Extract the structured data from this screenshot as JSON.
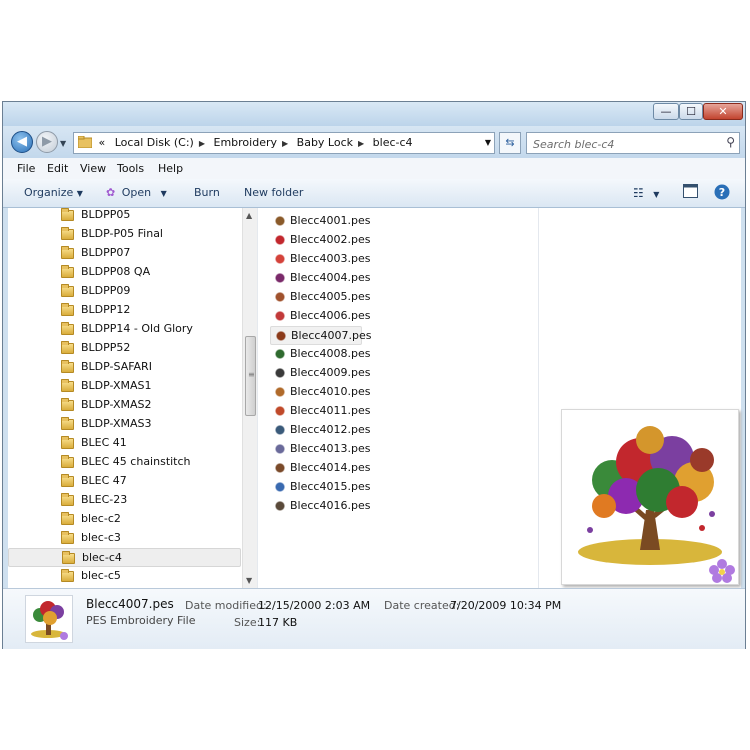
{
  "window": {
    "controls": {
      "minimize": "—",
      "maximize": "☐",
      "close": "✕"
    }
  },
  "address": {
    "overflow": "«",
    "crumbs": [
      "Local Disk (C:)",
      "Embroidery",
      "Baby Lock",
      "blec-c4"
    ],
    "search_placeholder": "Search blec-c4"
  },
  "menu": [
    "File",
    "Edit",
    "View",
    "Tools",
    "Help"
  ],
  "toolbar": {
    "organize": "Organize",
    "open": "Open",
    "burn": "Burn",
    "new_folder": "New folder"
  },
  "tree": [
    "BLDPP05",
    "BLDP-P05 Final",
    "BLDPP07",
    "BLDPP08 QA",
    "BLDPP09",
    "BLDPP12",
    "BLDPP14 - Old Glory",
    "BLDPP52",
    "BLDP-SAFARI",
    "BLDP-XMAS1",
    "BLDP-XMAS2",
    "BLDP-XMAS3",
    "BLEC 41",
    "BLEC 45 chainstitch",
    "BLEC 47",
    "BLEC-23",
    "blec-c2",
    "blec-c3",
    "blec-c4",
    "blec-c5"
  ],
  "tree_selected": 18,
  "files": [
    "Blecc4001.pes",
    "Blecc4002.pes",
    "Blecc4003.pes",
    "Blecc4004.pes",
    "Blecc4005.pes",
    "Blecc4006.pes",
    "Blecc4007.pes",
    "Blecc4008.pes",
    "Blecc4009.pes",
    "Blecc4010.pes",
    "Blecc4011.pes",
    "Blecc4012.pes",
    "Blecc4013.pes",
    "Blecc4014.pes",
    "Blecc4015.pes",
    "Blecc4016.pes"
  ],
  "file_selected": 6,
  "details": {
    "filename": "Blecc4007.pes",
    "filetype": "PES Embroidery File",
    "date_modified_label": "Date modified:",
    "date_modified": "12/15/2000 2:03 AM",
    "size_label": "Size:",
    "size": "117 KB",
    "date_created_label": "Date created:",
    "date_created": "7/20/2009 10:34 PM"
  },
  "colors": {
    "accent": "#2a6fb7",
    "selection": "#eeeeee"
  }
}
